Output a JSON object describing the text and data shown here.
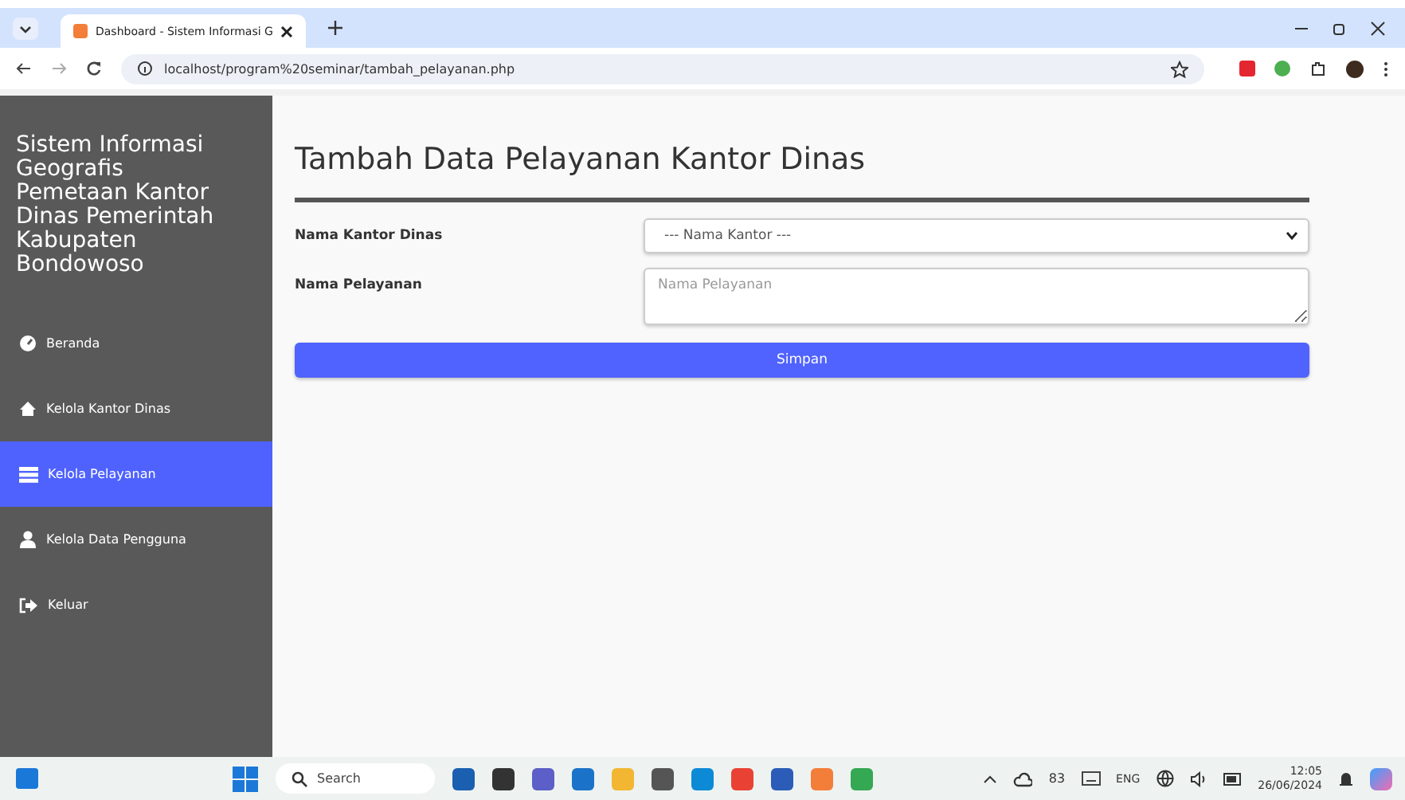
{
  "browser": {
    "tab_title": "Dashboard - Sistem Informasi G",
    "url": "localhost/program%20seminar/tambah_pelayanan.php"
  },
  "sidebar": {
    "title": "Sistem Informasi Geografis Pemetaan Kantor Dinas Pemerintah Kabupaten Bondowoso",
    "items": [
      {
        "label": "Beranda",
        "kind": "dashboard",
        "selected": false
      },
      {
        "label": "Kelola Kantor Dinas",
        "kind": "home",
        "selected": false
      },
      {
        "label": "Kelola Pelayanan",
        "kind": "list",
        "selected": true
      },
      {
        "label": "Kelola Data Pengguna",
        "kind": "user",
        "selected": false
      },
      {
        "label": "Keluar",
        "kind": "logout",
        "selected": false
      }
    ]
  },
  "page": {
    "heading": "Tambah Data Pelayanan Kantor Dinas",
    "fields": [
      {
        "label": "Nama Kantor Dinas",
        "kind": "select",
        "value": "--- Nama Kantor ---"
      },
      {
        "label": "Nama Pelayanan",
        "kind": "textarea",
        "placeholder": "Nama Pelayanan"
      }
    ],
    "button": "Simpan"
  },
  "taskbar": {
    "search_placeholder": "Search",
    "temperature": "83",
    "language": "ENG",
    "time": "12:05",
    "date": "26/06/2024"
  }
}
